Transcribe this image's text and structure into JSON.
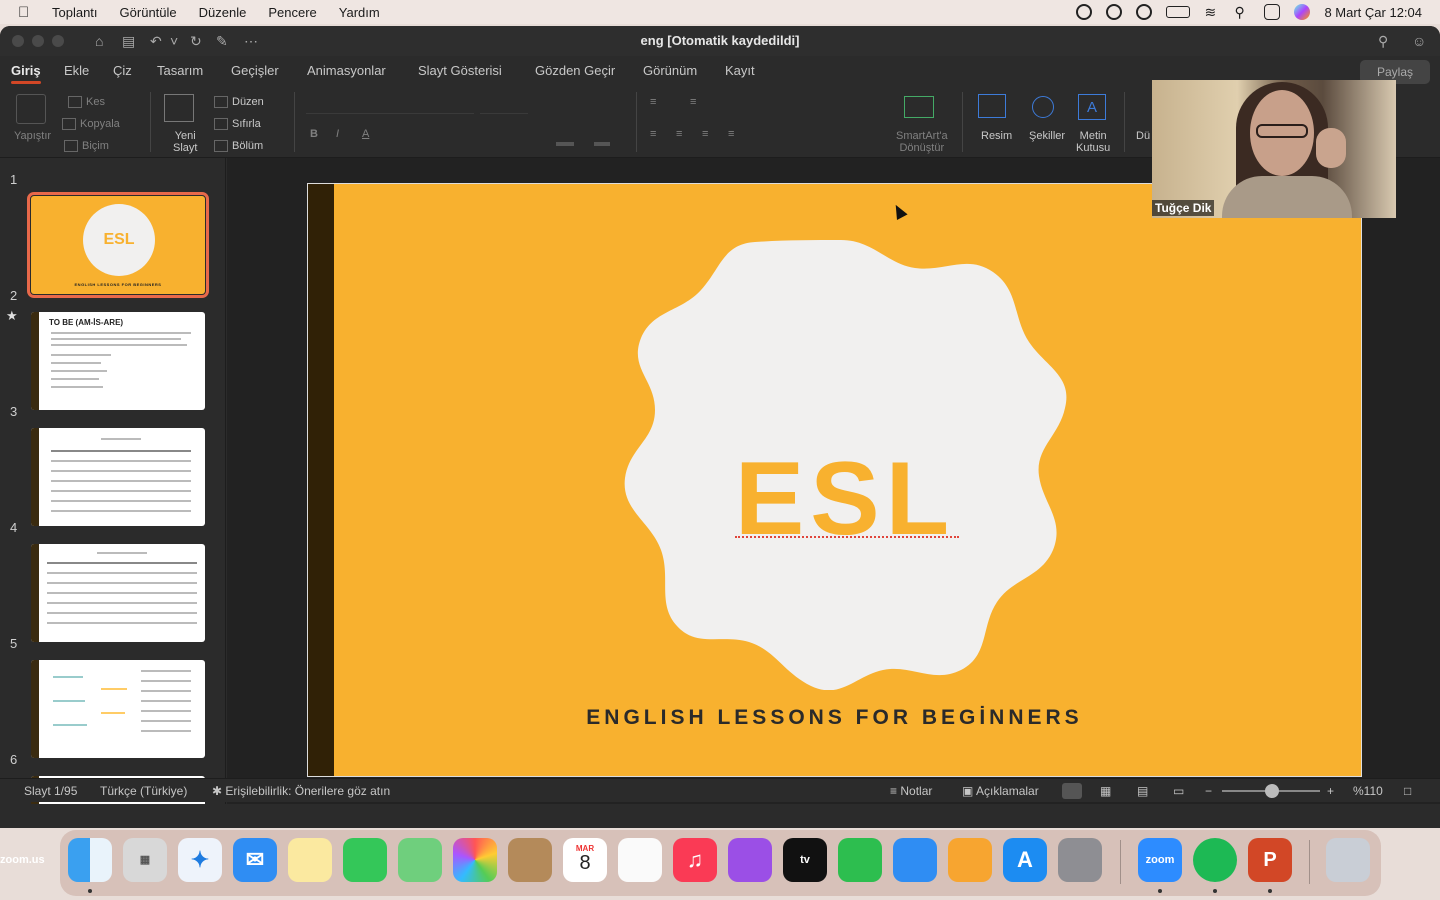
{
  "menubar": {
    "app_name": "zoom.us",
    "items": [
      "Toplantı",
      "Görüntüle",
      "Düzenle",
      "Pencere",
      "Yardım"
    ],
    "datetime": "8 Mart Çar  12:04"
  },
  "window": {
    "title": "eng [Otomatik kaydedildi]"
  },
  "ribbon_tabs": [
    "Giriş",
    "Ekle",
    "Çiz",
    "Tasarım",
    "Geçişler",
    "Animasyonlar",
    "Slayt Gösterisi",
    "Gözden Geçir",
    "Görünüm",
    "Kayıt"
  ],
  "share_label": "Paylaş",
  "ribbon": {
    "paste": "Yapıştır",
    "cut": "Kes",
    "copy": "Kopyala",
    "format": "Biçim",
    "new_slide_line1": "Yeni",
    "new_slide_line2": "Slayt",
    "layout": "Düzen",
    "reset": "Sıfırla",
    "section": "Bölüm",
    "smartart_line1": "SmartArt'a",
    "smartart_line2": "Dönüştür",
    "picture": "Resim",
    "shapes": "Şekiller",
    "textbox_line1": "Metin",
    "textbox_line2": "Kutusu",
    "arrange": "Dü"
  },
  "thumbnails": [
    {
      "num": "1",
      "title": "ESL",
      "subtitle": "ENGLISH LESSONS FOR BEGINNERS"
    },
    {
      "num": "2",
      "title": "TO BE (AM-İS-ARE)"
    },
    {
      "num": "3"
    },
    {
      "num": "4"
    },
    {
      "num": "5"
    },
    {
      "num": "6"
    }
  ],
  "slide": {
    "title": "ESL",
    "subtitle": "ENGLISH LESSONS FOR BEGİNNERS"
  },
  "video": {
    "participant_name": "Tuğçe Dik"
  },
  "statusbar": {
    "slide_index": "Slayt 1/95",
    "language": "Türkçe (Türkiye)",
    "accessibility": "Erişilebilirlik: Önerilere göz atın",
    "notes": "Notlar",
    "comments": "Açıklamalar",
    "zoom": "%110"
  },
  "dock": {
    "calendar_month": "MAR",
    "calendar_day": "8",
    "zoom_label": "zoom",
    "tv_label": "tv"
  },
  "colors": {
    "slide_bg": "#f8b12f",
    "slide_bar": "#302106",
    "accent_tab": "#d24726"
  }
}
